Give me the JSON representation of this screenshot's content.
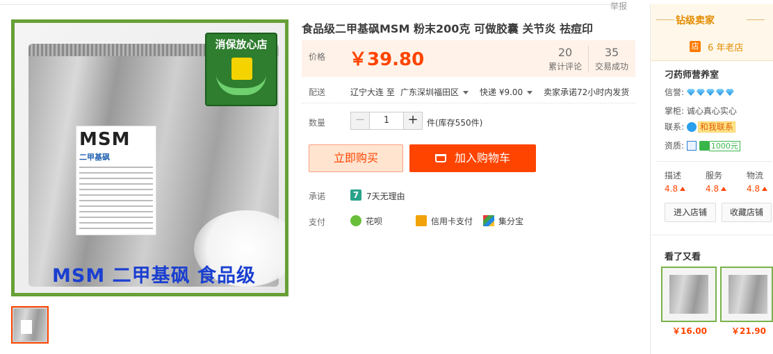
{
  "header": {
    "report_label": "举报"
  },
  "product": {
    "image_badge": "消保放心店",
    "image_label_brand": "MSM",
    "image_label_sub": "二甲基砜",
    "image_caption": "MSM 二甲基砜 食品级",
    "title": "食品级二甲基砜MSM 粉末200克 可做胶囊 关节炎 祛痘印",
    "price_label": "价格",
    "price": "￥39.80",
    "reviews_count": "20",
    "reviews_label": "累计评论",
    "sales_count": "35",
    "sales_label": "交易成功"
  },
  "shipping": {
    "label": "配送",
    "from": "辽宁大连",
    "to_word": "至",
    "destination": "广东深圳福田区",
    "method": "快递 ¥9.00",
    "promise": "卖家承诺72小时内发货"
  },
  "quantity": {
    "label": "数量",
    "minus": "−",
    "value": "1",
    "plus": "+",
    "stock": "件(库存550件)"
  },
  "actions": {
    "buy_now": "立即购买",
    "add_cart": "加入购物车"
  },
  "promise": {
    "label": "承诺",
    "icon_text": "7",
    "text": "7天无理由"
  },
  "payment": {
    "label": "支付",
    "methods": [
      "花呗",
      "信用卡支付",
      "集分宝"
    ]
  },
  "seller": {
    "level_title": "钻级卖家",
    "years_icon": "店",
    "years": "6 年老店",
    "shop_name": "刁药师营养室",
    "credit_label": "信誉:",
    "keeper_label": "掌柜:",
    "keeper_name": "诚心真心实心",
    "contact_label": "联系:",
    "contact_button": "和我联系",
    "qualification_label": "资质:",
    "deposit": "1000元",
    "scores": [
      {
        "label": "描述",
        "value": "4.8"
      },
      {
        "label": "服务",
        "value": "4.8"
      },
      {
        "label": "物流",
        "value": "4.8"
      }
    ],
    "enter_shop": "进入店铺",
    "favorite_shop": "收藏店铺"
  },
  "also_viewed": {
    "title": "看了又看",
    "items": [
      {
        "price": "￥16.00"
      },
      {
        "price": "￥21.90"
      }
    ]
  },
  "colors": {
    "accent": "#ff4400",
    "image_border": "#66a036",
    "seller_gold": "#e38b00"
  }
}
